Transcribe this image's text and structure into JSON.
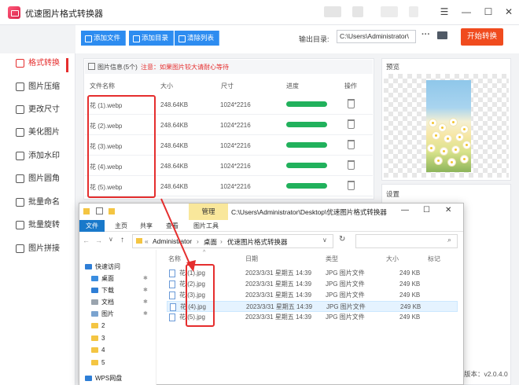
{
  "app": {
    "title": "优速图片格式转换器"
  },
  "toolbar": {
    "add_file": "添加文件",
    "add_dir": "添加目录",
    "clear": "清除列表",
    "output_label": "输出目录:",
    "output_path": "C:\\Users\\Administrator\\",
    "browse": "···",
    "start": "开始转换"
  },
  "sidebar": {
    "items": [
      {
        "label": "格式转换",
        "icon": "format-convert-icon"
      },
      {
        "label": "图片压缩",
        "icon": "compress-icon"
      },
      {
        "label": "更改尺寸",
        "icon": "resize-icon"
      },
      {
        "label": "美化图片",
        "icon": "beautify-icon"
      },
      {
        "label": "添加水印",
        "icon": "watermark-icon"
      },
      {
        "label": "图片圆角",
        "icon": "round-corner-icon"
      },
      {
        "label": "批量命名",
        "icon": "rename-icon"
      },
      {
        "label": "批量旋转",
        "icon": "rotate-icon"
      },
      {
        "label": "图片拼接",
        "icon": "stitch-icon"
      }
    ]
  },
  "info": {
    "title": "图片信息",
    "count": "(5个)",
    "warning": "注意：如果图片较大请耐心等待"
  },
  "columns": {
    "name": "文件名称",
    "size": "大小",
    "dims": "尺寸",
    "progress": "进度",
    "action": "操作"
  },
  "files": [
    {
      "name": "花 (1).webp",
      "size": "248.64KB",
      "dims": "1024*2216",
      "progress": 1.0
    },
    {
      "name": "花 (2).webp",
      "size": "248.64KB",
      "dims": "1024*2216",
      "progress": 1.0
    },
    {
      "name": "花 (3).webp",
      "size": "248.64KB",
      "dims": "1024*2216",
      "progress": 1.0
    },
    {
      "name": "花 (4).webp",
      "size": "248.64KB",
      "dims": "1024*2216",
      "progress": 1.0
    },
    {
      "name": "花 (5).webp",
      "size": "248.64KB",
      "dims": "1024*2216",
      "progress": 1.0
    }
  ],
  "preview": {
    "title": "预览"
  },
  "settings": {
    "title": "设置"
  },
  "version": "版本：v2.0.4.0",
  "explorer": {
    "manage_tab": "管理",
    "path": "C:\\Users\\Administrator\\Desktop\\优速图片格式转换器",
    "ribbon": {
      "file": "文件",
      "home": "主页",
      "share": "共享",
      "view": "查看",
      "tools": "图片工具"
    },
    "breadcrumb": [
      "Administrator",
      "桌面",
      "优速图片格式转换器"
    ],
    "nav": [
      {
        "label": "快速访问"
      },
      {
        "label": "桌面"
      },
      {
        "label": "下载"
      },
      {
        "label": "文档"
      },
      {
        "label": "图片"
      },
      {
        "label": "2"
      },
      {
        "label": "3"
      },
      {
        "label": "4"
      },
      {
        "label": "5"
      },
      {
        "label": "WPS网盘"
      }
    ],
    "columns": {
      "name": "名称",
      "date": "日期",
      "type": "类型",
      "size": "大小",
      "tags": "标记"
    },
    "files": [
      {
        "name": "花 (1).jpg",
        "date": "2023/3/31 星期五 14:39",
        "type": "JPG 图片文件",
        "size": "249 KB"
      },
      {
        "name": "花 (2).jpg",
        "date": "2023/3/31 星期五 14:39",
        "type": "JPG 图片文件",
        "size": "249 KB"
      },
      {
        "name": "花 (3).jpg",
        "date": "2023/3/31 星期五 14:39",
        "type": "JPG 图片文件",
        "size": "249 KB"
      },
      {
        "name": "花 (4).jpg",
        "date": "2023/3/31 星期五 14:39",
        "type": "JPG 图片文件",
        "size": "249 KB"
      },
      {
        "name": "花 (5).jpg",
        "date": "2023/3/31 星期五 14:39",
        "type": "JPG 图片文件",
        "size": "249 KB"
      }
    ]
  },
  "colors": {
    "accent": "#2d8cf0",
    "start": "#f04b1e",
    "active": "#e52e2e",
    "progress": "#21b15c",
    "ribbon_file": "#1979ca",
    "manage": "#f9e79b"
  }
}
